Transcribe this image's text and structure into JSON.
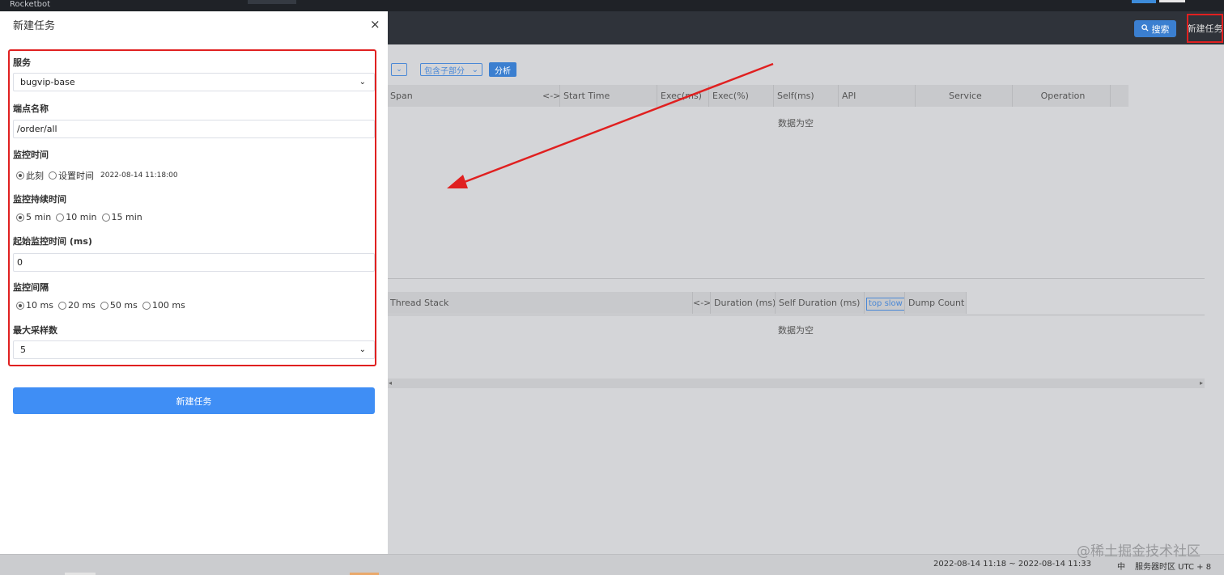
{
  "app": {
    "brand": "Rocketbot"
  },
  "toolbar": {
    "search_label": "搜索",
    "new_task_label": "新建任务"
  },
  "filters": {
    "include_option": "包含子部分",
    "analyze_label": "分析"
  },
  "span_table": {
    "columns": [
      "Span",
      "<->",
      "Start Time",
      "Exec(ms)",
      "Exec(%)",
      "Self(ms)",
      "API",
      "Service",
      "Operation"
    ],
    "empty_text": "数据为空"
  },
  "thread_table": {
    "columns": [
      "Thread Stack",
      "<->",
      "Duration (ms)",
      "Self Duration (ms)",
      "top slow",
      "Dump Count"
    ],
    "empty_text": "数据为空"
  },
  "drawer": {
    "title": "新建任务",
    "close": "×",
    "service": {
      "label": "服务",
      "value": "bugvip-base"
    },
    "endpoint": {
      "label": "端点名称",
      "value": "/order/all"
    },
    "monitor_time": {
      "label": "监控时间",
      "options": [
        "此刻",
        "设置时间"
      ],
      "selected": 0,
      "timestamp": "2022-08-14 11:18:00"
    },
    "duration": {
      "label": "监控持续时间",
      "options": [
        "5 min",
        "10 min",
        "15 min"
      ],
      "selected": 0
    },
    "start_time": {
      "label": "起始监控时间 (ms)",
      "value": "0"
    },
    "interval": {
      "label": "监控间隔",
      "options": [
        "10 ms",
        "20 ms",
        "50 ms",
        "100 ms"
      ],
      "selected": 0
    },
    "max_samples": {
      "label": "最大采样数",
      "value": "5"
    },
    "submit_label": "新建任务"
  },
  "footer": {
    "range": "2022-08-14 11:18 ~ 2022-08-14 11:33",
    "lang": "中",
    "timezone": "服务器时区 UTC + 8"
  },
  "watermark": "@稀土掘金技术社区",
  "colors": {
    "primary": "#3f8ef5",
    "annotation_red": "#e02020"
  },
  "icons": {
    "search": "search-icon",
    "close": "close-icon",
    "chevron": "chevron-down-icon"
  }
}
